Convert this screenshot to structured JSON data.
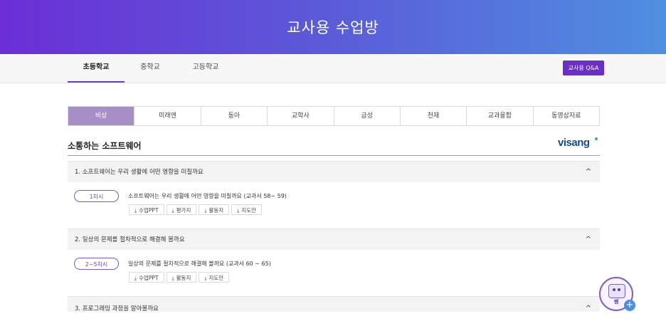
{
  "banner": {
    "title": "교사용 수업방"
  },
  "topnav": {
    "items": [
      {
        "label": "초등학교",
        "active": true
      },
      {
        "label": "중학교",
        "active": false
      },
      {
        "label": "고등학교",
        "active": false
      }
    ],
    "qa_label": "교사용 Q&A"
  },
  "tabs": [
    {
      "label": "비상",
      "active": true
    },
    {
      "label": "미래엔",
      "active": false
    },
    {
      "label": "동아",
      "active": false
    },
    {
      "label": "교학사",
      "active": false
    },
    {
      "label": "금성",
      "active": false
    },
    {
      "label": "천재",
      "active": false
    },
    {
      "label": "교과융합",
      "active": false
    },
    {
      "label": "동영상자료",
      "active": false
    }
  ],
  "section": {
    "title": "소통하는 소프트웨어",
    "logo": "visang"
  },
  "chapters": [
    {
      "title": "1. 소프트웨어는 우리 생활에 어떤 영향을 미칠까요",
      "chevron": "^",
      "session": "1차시",
      "lesson": "소프트웨어는 우리 생활에 어떤 영향을 미칠까요 (교과서 58~ 59)",
      "downloads": [
        "수업PPT",
        "평가지",
        "활동지",
        "지도안"
      ]
    },
    {
      "title": "2. 일상의 문제를 절차적으로 해결해 볼까요",
      "chevron": "^",
      "session": "2~5차시",
      "lesson": "일상의 문제를 절차적으로 해결해 볼까요 (교과서 60 ~ 65)",
      "downloads": [
        "수업PPT",
        "활동지",
        "지도안"
      ]
    },
    {
      "title": "3. 프로그래밍 과정을 알아볼까요",
      "chevron": "^"
    }
  ],
  "fab": {
    "label": "쌤",
    "plus": "+"
  },
  "icons": {
    "download": "download-icon",
    "chevron": "chevron-up-icon",
    "robot": "robot-icon"
  },
  "colors": {
    "accent": "#6a2fc6",
    "tab_active": "#a58fc6",
    "banner_start": "#6b2fd6",
    "banner_end": "#4f8fe0"
  }
}
